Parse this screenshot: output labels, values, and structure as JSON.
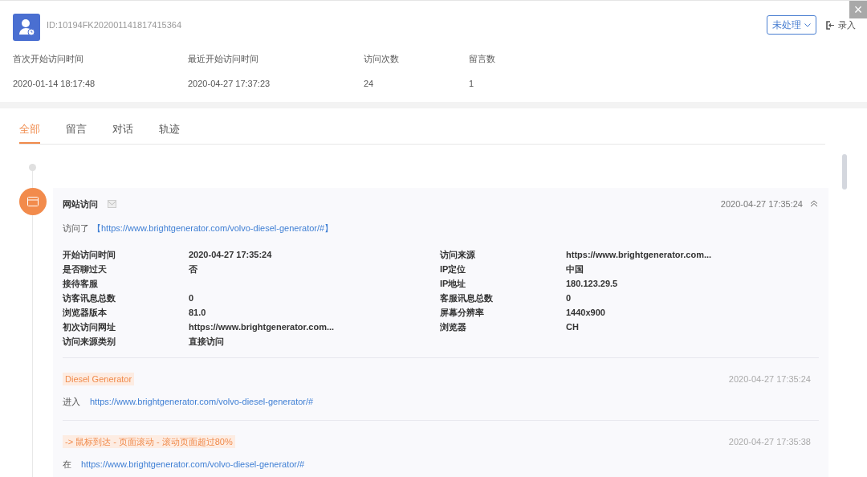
{
  "visitor": {
    "id": "ID:10194FK202001141817415364",
    "status_button": "未处理",
    "import_button": "录入",
    "close": "×"
  },
  "stats": [
    {
      "label": "首次开始访问时间",
      "value": "2020-01-14 18:17:48"
    },
    {
      "label": "最近开始访问时间",
      "value": "2020-04-27 17:37:23"
    },
    {
      "label": "访问次数",
      "value": "24"
    },
    {
      "label": "留言数",
      "value": "1"
    }
  ],
  "tabs": [
    {
      "label": "全部",
      "selected": true
    },
    {
      "label": "留言",
      "selected": false
    },
    {
      "label": "对话",
      "selected": false
    },
    {
      "label": "轨迹",
      "selected": false
    }
  ],
  "visit": {
    "title": "网站访问",
    "timestamp": "2020-04-27 17:35:24",
    "expanded": true,
    "visited_prefix": "访问了",
    "visited_url": "【https://www.brightgenerator.com/volvo-diesel-generator/#】",
    "details_left": [
      {
        "label": "开始访问时间",
        "value": "2020-04-27 17:35:24"
      },
      {
        "label": "是否聊过天",
        "value": "否"
      },
      {
        "label": "接待客服"
      },
      {
        "label": "访客讯息总数",
        "value": "0"
      },
      {
        "label": "浏览器版本",
        "value": "81.0"
      },
      {
        "label": "初次访问网址",
        "value": "https://www.brightgenerator.com..."
      },
      {
        "label": "访问来源类别",
        "value": "直接访问"
      }
    ],
    "details_right": [
      {
        "label": "访问来源",
        "value": "https://www.brightgenerator.com..."
      },
      {
        "label": "IP定位",
        "value": "中国"
      },
      {
        "label": "IP地址",
        "value": "180.123.29.5"
      },
      {
        "label": "客服讯息总数",
        "value": "0"
      },
      {
        "label": "屏幕分辨率",
        "value": "1440x900"
      },
      {
        "label": "浏览器",
        "value": "CH"
      }
    ]
  },
  "events": [
    {
      "tag": "Diesel Generator",
      "timestamp": "2020-04-27 17:35:24",
      "prefix": "进入",
      "url": "https://www.brightgenerator.com/volvo-diesel-generator/#"
    },
    {
      "tag": "-> 鼠标到达 - 页面滚动 - 滚动页面超过80%",
      "timestamp": "2020-04-27 17:35:38",
      "prefix": "在",
      "url": "https://www.brightgenerator.com/volvo-diesel-generator/#"
    }
  ]
}
